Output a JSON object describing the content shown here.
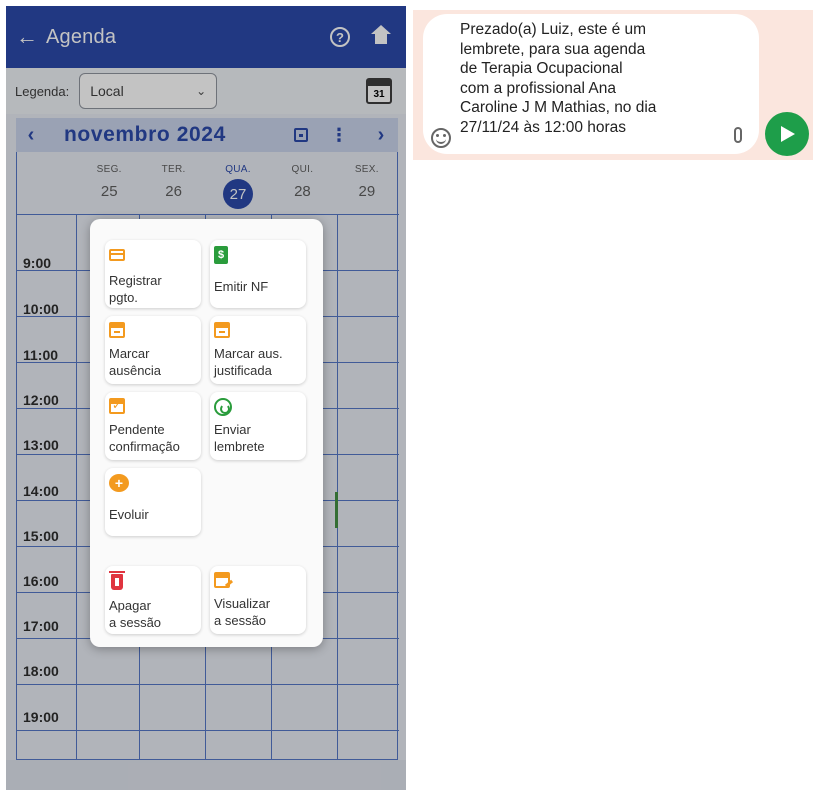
{
  "appbar": {
    "back_icon": "arrow-left-icon",
    "title": "Agenda",
    "help_icon": "help-circle-icon",
    "home_icon": "home-icon"
  },
  "legend": {
    "label": "Legenda:",
    "selected": "Local",
    "calendar_badge": "31"
  },
  "calendar": {
    "month_label": "novembro 2024",
    "prev": "‹",
    "next": "›",
    "days": [
      {
        "dow": "SEG.",
        "num": "25"
      },
      {
        "dow": "TER.",
        "num": "26"
      },
      {
        "dow": "QUA.",
        "num": "27"
      },
      {
        "dow": "QUI.",
        "num": "28"
      },
      {
        "dow": "SEX.",
        "num": "29"
      }
    ],
    "times": [
      "9:00",
      "10:00",
      "11:00",
      "12:00",
      "13:00",
      "14:00",
      "15:00",
      "16:00",
      "17:00",
      "18:00",
      "19:00"
    ]
  },
  "menu": {
    "register_payment": "Registrar\npgto.",
    "issue_invoice": "Emitir NF",
    "mark_absence": "Marcar\nausência",
    "mark_justified_absence": "Marcar aus.\njustificada",
    "pending_confirmation": "Pendente\nconfirmação",
    "send_reminder": "Enviar\nlembrete",
    "evolve": "Evoluir",
    "delete_session": "Apagar\na sessão",
    "view_session": "Visualizar\na sessão",
    "invoice_icon_glyph": "$",
    "evolve_icon_glyph": "+"
  },
  "whatsapp": {
    "message": "Prezado(a) Luiz, este é um\nlembrete, para sua agenda\nde Terapia Ocupacional\ncom a profissional Ana\nCaroline J M Mathias, no dia\n27/11/24 às 12:00 horas"
  },
  "colors": {
    "primary": "#1f3fa6",
    "accent_orange": "#f39a1f",
    "accent_green": "#2a9c3c",
    "danger": "#e0343f",
    "send_green": "#1e9e4a"
  }
}
